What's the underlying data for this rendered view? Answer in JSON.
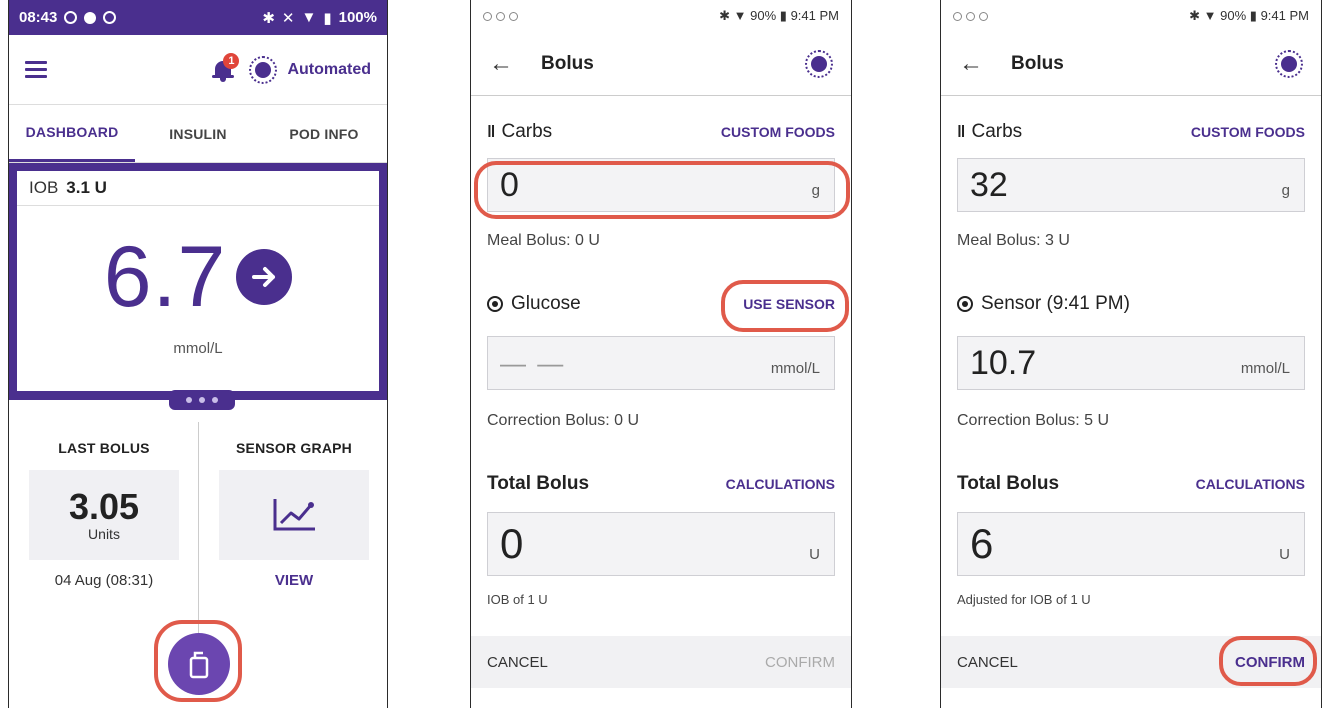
{
  "phone1": {
    "status_bar": {
      "time": "08:43",
      "battery": "100%"
    },
    "notification_count": "1",
    "mode_label": "Automated",
    "tabs": [
      {
        "label": "DASHBOARD"
      },
      {
        "label": "INSULIN"
      },
      {
        "label": "POD INFO"
      }
    ],
    "active_tab": "DASHBOARD",
    "iob_label": "IOB",
    "iob_value": "3.1 U",
    "glucose_value": "6.7",
    "glucose_trend": "steady-right-arrow",
    "glucose_unit": "mmol/L",
    "last_bolus": {
      "title": "LAST BOLUS",
      "value": "3.05",
      "unit": "Units",
      "time": "04 Aug (08:31)"
    },
    "sensor_graph": {
      "title": "SENSOR GRAPH",
      "link": "VIEW"
    },
    "colors": {
      "brand_purple": "#4a2f8e",
      "highlight_red": "#e05a4a"
    }
  },
  "phone2": {
    "status_bar": {
      "battery": "90%",
      "time": "9:41 PM"
    },
    "title": "Bolus",
    "carbs_label": "Carbs",
    "custom_foods": "CUSTOM FOODS",
    "carbs_value": "0",
    "carbs_unit": "g",
    "meal_bolus": "Meal Bolus: 0 U",
    "glucose_label": "Glucose",
    "use_sensor": "USE SENSOR",
    "glucose_placeholder": "— —",
    "glucose_unit": "mmol/L",
    "correction_bolus": "Correction Bolus: 0 U",
    "total_bolus_label": "Total Bolus",
    "calculations": "CALCULATIONS",
    "total_value": "0",
    "total_unit": "U",
    "iob_note": "IOB of 1 U",
    "cancel": "CANCEL",
    "confirm": "CONFIRM"
  },
  "phone3": {
    "status_bar": {
      "battery": "90%",
      "time": "9:41 PM"
    },
    "title": "Bolus",
    "carbs_label": "Carbs",
    "custom_foods": "CUSTOM FOODS",
    "carbs_value": "32",
    "carbs_unit": "g",
    "meal_bolus": "Meal Bolus: 3 U",
    "sensor_label": "Sensor (9:41 PM)",
    "sensor_value": "10.7",
    "sensor_unit": "mmol/L",
    "correction_bolus": "Correction Bolus: 5 U",
    "total_bolus_label": "Total Bolus",
    "calculations": "CALCULATIONS",
    "total_value": "6",
    "total_unit": "U",
    "iob_note": "Adjusted for IOB of 1 U",
    "cancel": "CANCEL",
    "confirm": "CONFIRM"
  }
}
